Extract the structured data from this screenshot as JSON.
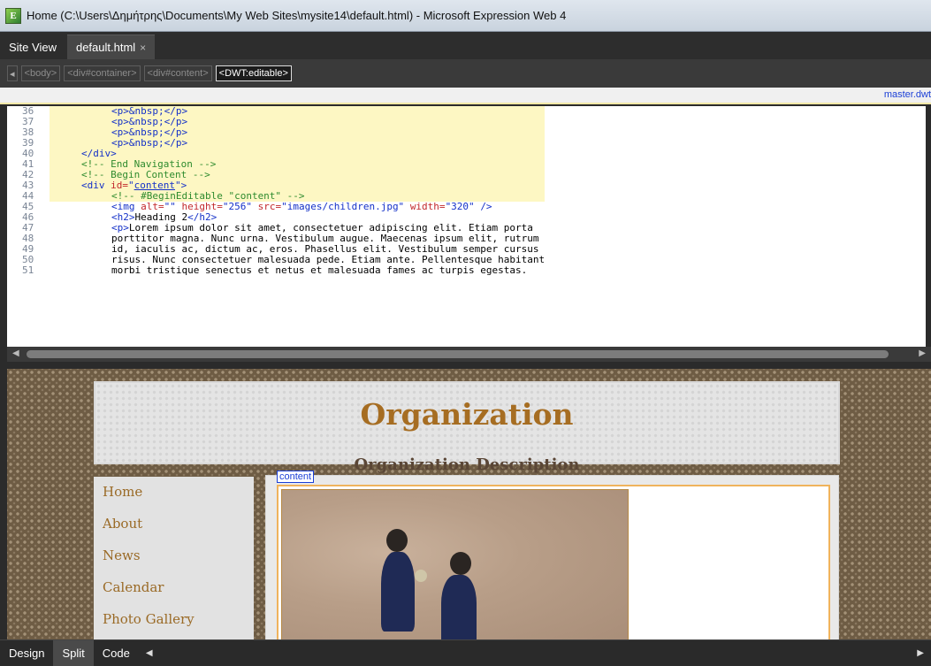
{
  "window": {
    "title": "Home (C:\\Users\\Δημήτρης\\Documents\\My Web Sites\\mysite14\\default.html) - Microsoft Expression Web 4",
    "icon": "expression-web-app-icon"
  },
  "tabs": [
    {
      "label": "Site View"
    },
    {
      "label": "default.html",
      "close": "×"
    }
  ],
  "breadcrumbs": [
    "<body>",
    "<div#container>",
    "<div#content>",
    "<DWT:editable>"
  ],
  "filebar": {
    "master": "master.dwt"
  },
  "code_lines": [
    {
      "n": "36"
    },
    {
      "n": "37"
    },
    {
      "n": "38"
    },
    {
      "n": "39"
    },
    {
      "n": "40"
    },
    {
      "n": "41"
    },
    {
      "n": "42"
    },
    {
      "n": "43"
    },
    {
      "n": "44"
    },
    {
      "n": "45"
    },
    {
      "n": "46"
    },
    {
      "n": "47"
    },
    {
      "n": "48"
    },
    {
      "n": "49"
    },
    {
      "n": "50"
    },
    {
      "n": "51"
    }
  ],
  "code": {
    "l36": "<p>&nbsp;</p>",
    "l40": "</div>",
    "l41": "<!-- End Navigation -->",
    "l42": "<!-- Begin Content -->",
    "l43_a": "<div ",
    "l43_b": "id=",
    "l43_c": "\"",
    "l43_d": "content",
    "l43_e": "\">",
    "l44": "<!-- #BeginEditable \"content\" -->",
    "l45_a": "<img ",
    "l45_b": "alt=",
    "l45_c": "\"\" ",
    "l45_d": "height=",
    "l45_e": "\"256\" ",
    "l45_f": "src=",
    "l45_g": "\"images/children.jpg\" ",
    "l45_h": "width=",
    "l45_i": "\"320\" ",
    "l45_j": "/>",
    "l46_a": "<h2>",
    "l46_b": "Heading 2",
    "l46_c": "</h2>",
    "l47_a": "<p>",
    "l47_b": "Lorem ipsum dolor sit amet, consectetuer adipiscing elit. Etiam porta",
    "l48": "porttitor magna. Nunc urna. Vestibulum augue. Maecenas ipsum elit, rutrum",
    "l49": "id, iaculis ac, dictum ac, eros. Phasellus elit. Vestibulum semper cursus",
    "l50": "risus. Nunc consectetuer malesuada pede. Etiam ante. Pellentesque habitant",
    "l51": "morbi tristique senectus et netus et malesuada fames ac turpis egestas."
  },
  "design": {
    "org_name": "Organization",
    "org_desc": "Organization Description",
    "nav": [
      "Home",
      "About",
      "News",
      "Calendar",
      "Photo Gallery"
    ],
    "content_label": "content"
  },
  "view_buttons": [
    "Design",
    "Split",
    "Code"
  ],
  "active_view": "Split"
}
